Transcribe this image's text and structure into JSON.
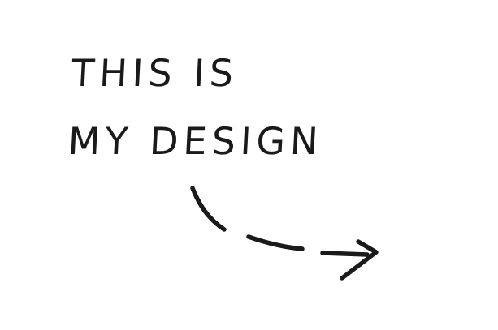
{
  "note": {
    "line1": "THIS IS",
    "line2": "MY DESIGN"
  },
  "arrow": {
    "icon": "dashed-curved-arrow-icon",
    "color": "#1a1a1a"
  },
  "colors": {
    "background": "#ffffff",
    "ink": "#1a1a1a"
  }
}
